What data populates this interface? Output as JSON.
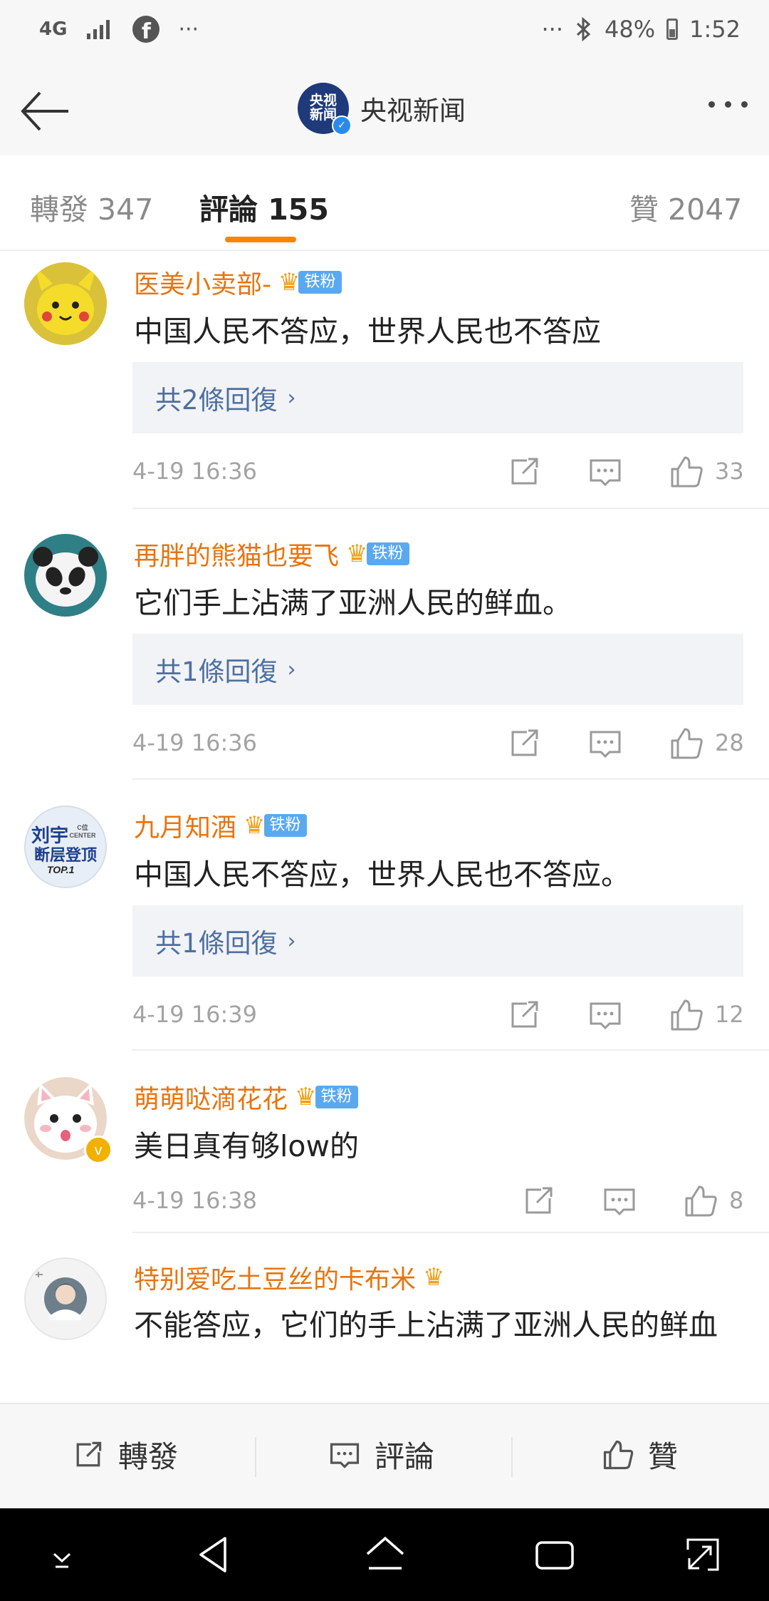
{
  "status_bar": {
    "network": "4G",
    "icons": [
      "signal-icon",
      "facebook-icon",
      "more-notifications-icon",
      "bluetooth-icon",
      "battery-icon"
    ],
    "left_more": "···",
    "right_more": "···",
    "fb_letter": "f",
    "battery": "48%",
    "time": "1:52"
  },
  "header": {
    "logo_top": "央视",
    "logo_bottom": "新闻",
    "title": "央视新闻",
    "verified_mark": "✓"
  },
  "tabs": [
    {
      "label": "轉發",
      "count": "347"
    },
    {
      "label": "評論",
      "count": "155",
      "active": true
    },
    {
      "label": "贊",
      "count": "2047"
    }
  ],
  "comments": [
    {
      "name": "医美小卖部-",
      "badge": "铁粉",
      "crown": "♛",
      "text": "中国人民不答应，世界人民也不答应",
      "replies": "共2條回復",
      "time": "4-19 16:36",
      "likes": "33"
    },
    {
      "name": "再胖的熊猫也要飞",
      "badge": "铁粉",
      "crown": "♛",
      "text": "它们手上沾满了亚洲人民的鲜血。",
      "replies": "共1條回復",
      "time": "4-19 16:36",
      "likes": "28"
    },
    {
      "name": "九月知酒",
      "badge": "铁粉",
      "crown": "♛",
      "text": "中国人民不答应，世界人民也不答应。",
      "replies": "共1條回復",
      "time": "4-19 16:39",
      "likes": "12",
      "avatar_text_1": "刘宇",
      "avatar_text_2": "断层登顶",
      "avatar_text_3": "TOP.1",
      "avatar_text_4": "C位 CENTER"
    },
    {
      "name": "萌萌哒滴花花",
      "badge": "铁粉",
      "crown": "♛",
      "text": "美日真有够low的",
      "time": "4-19 16:38",
      "likes": "8",
      "avatar_badge": "v"
    },
    {
      "name": "特别爱吃土豆丝的卡布米",
      "crown": "♛",
      "text": "不能答应，它们的手上沾满了亚洲人民的鲜血"
    }
  ],
  "reply_chevron": "›",
  "bottom_bar": {
    "repost": "轉發",
    "comment": "評論",
    "like": "贊"
  },
  "colors": {
    "accent_orange": "#ff8200",
    "username_orange": "#e8740f",
    "reply_link_blue": "#4d70a0",
    "fan_badge_blue": "#5aa9f0"
  }
}
